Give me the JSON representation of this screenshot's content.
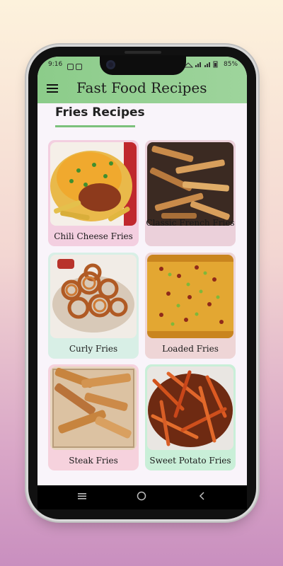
{
  "status_bar": {
    "time": "9:16",
    "battery": "85%"
  },
  "app_bar": {
    "title": "Fast Food Recipes",
    "menu_icon": "hamburger-menu-icon"
  },
  "section": {
    "title": "Fries Recipes",
    "accent_color": "#7cc17c"
  },
  "recipes": [
    {
      "label": "Chili Cheese Fries",
      "card_color": "#f3cfe0"
    },
    {
      "label": "Classic French Fries",
      "card_color": "#ebd0da"
    },
    {
      "label": "Curly Fries",
      "card_color": "#d8efe6"
    },
    {
      "label": "Loaded Fries",
      "card_color": "#eed5d6"
    },
    {
      "label": "Steak Fries",
      "card_color": "#f6d2dd"
    },
    {
      "label": "Sweet Potato Fries",
      "card_color": "#c9efd8"
    }
  ],
  "nav_bar": {
    "recents": "recents-icon",
    "home": "home-icon",
    "back": "back-icon"
  }
}
